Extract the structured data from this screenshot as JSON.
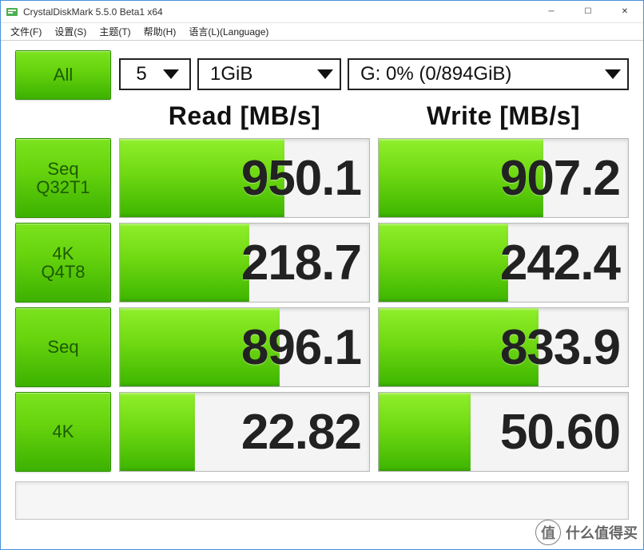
{
  "window": {
    "title": "CrystalDiskMark 5.5.0 Beta1 x64"
  },
  "menu": {
    "file": "文件(F)",
    "settings": "设置(S)",
    "theme": "主题(T)",
    "help": "帮助(H)",
    "language": "语言(L)(Language)"
  },
  "controls": {
    "all_label": "All",
    "count": "5",
    "size": "1GiB",
    "drive": "G: 0% (0/894GiB)"
  },
  "headers": {
    "read": "Read [MB/s]",
    "write": "Write [MB/s]"
  },
  "tests": [
    {
      "label1": "Seq",
      "label2": "Q32T1",
      "read": "950.1",
      "write": "907.2",
      "read_pct": "66%",
      "write_pct": "66%"
    },
    {
      "label1": "4K",
      "label2": "Q4T8",
      "read": "218.7",
      "write": "242.4",
      "read_pct": "52%",
      "write_pct": "52%"
    },
    {
      "label1": "Seq",
      "label2": "",
      "read": "896.1",
      "write": "833.9",
      "read_pct": "64%",
      "write_pct": "64%"
    },
    {
      "label1": "4K",
      "label2": "",
      "read": "22.82",
      "write": "50.60",
      "read_pct": "30%",
      "write_pct": "37%"
    }
  ],
  "watermark": {
    "badge": "值",
    "text": "什么值得买"
  }
}
